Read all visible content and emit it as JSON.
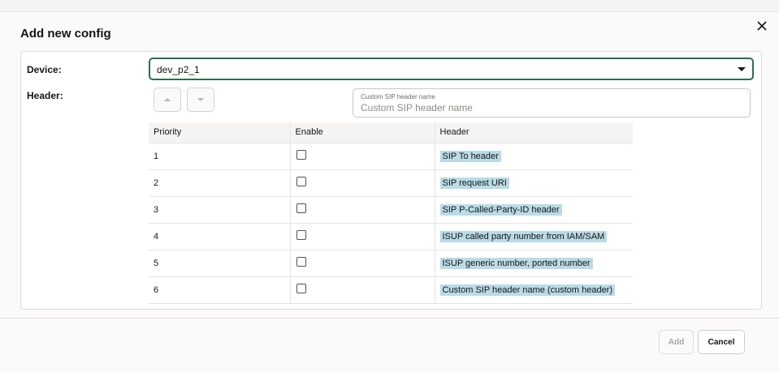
{
  "dialog": {
    "title": "Add new config",
    "close_icon": "close-icon"
  },
  "form": {
    "device_label": "Device:",
    "device_value": "dev_p2_1",
    "header_label": "Header:",
    "move_up_icon": "triangle-up-icon",
    "move_down_icon": "triangle-down-icon",
    "custom_header_label": "Custom SIP header name",
    "custom_header_placeholder": "Custom SIP header name"
  },
  "table": {
    "columns": [
      "Priority",
      "Enable",
      "Header"
    ],
    "rows": [
      {
        "priority": "1",
        "enabled": false,
        "header": "SIP To header"
      },
      {
        "priority": "2",
        "enabled": false,
        "header": "SIP request URI"
      },
      {
        "priority": "3",
        "enabled": false,
        "header": "SIP P-Called-Party-ID header"
      },
      {
        "priority": "4",
        "enabled": false,
        "header": "ISUP called party number from IAM/SAM"
      },
      {
        "priority": "5",
        "enabled": false,
        "header": "ISUP generic number, ported number"
      },
      {
        "priority": "6",
        "enabled": false,
        "header": "Custom SIP header name (custom header)"
      }
    ]
  },
  "footer": {
    "add_label": "Add",
    "cancel_label": "Cancel"
  },
  "colors": {
    "focus_border": "#2c6e4f",
    "header_highlight": "#b9dbe6"
  }
}
